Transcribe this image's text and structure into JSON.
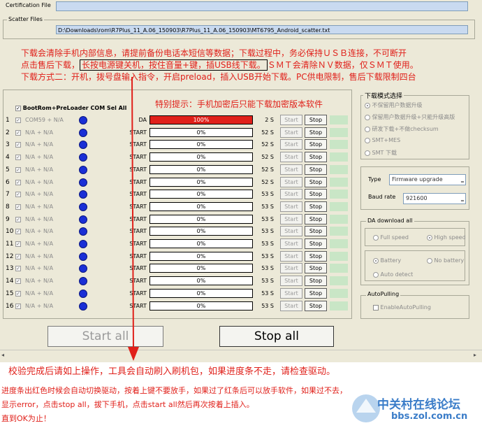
{
  "certification": {
    "label": "Certification File",
    "value": ""
  },
  "scatter": {
    "label": "Scatter Files",
    "value": "D:\\Downloads\\rom\\R7Plus_11_A.06_150903\\R7Plus_11_A.06_150903\\MT6795_Android_scatter.txt"
  },
  "notes": {
    "line1": "下载会清除手机内部信息，请提前备份电话本短信等数据；下载过程中，务必保持ＵＳＢ连接，不可断开",
    "line2a": "点击售后下载，",
    "line2b": "长按电源键关机，按住音量+键，插USB线下载。",
    "line2c": "ＳＭＴ会清除ＮＶ数据，仅ＳＭＴ使用。",
    "line3": "下载方式二：开机，拨号盘输入指令，开启preload，插入USB开始下载。PC供电限制，售后下载限制四台"
  },
  "toggle_all_label": "BootRom+PreLoader COM Sel All",
  "tip": "特别提示：手机加密后只能下载加密版本软件",
  "rows": [
    {
      "num": "1",
      "port": "COM59 + N/A",
      "stage": "DA",
      "progress": "100%",
      "progress_value": 100,
      "time": "2 S",
      "start": "Start",
      "stop": "Stop"
    },
    {
      "num": "2",
      "port": "N/A + N/A",
      "stage": "START",
      "progress": "0%",
      "progress_value": 0,
      "time": "52 S",
      "start": "Start",
      "stop": "Stop"
    },
    {
      "num": "3",
      "port": "N/A + N/A",
      "stage": "START",
      "progress": "0%",
      "progress_value": 0,
      "time": "52 S",
      "start": "Start",
      "stop": "Stop"
    },
    {
      "num": "4",
      "port": "N/A + N/A",
      "stage": "START",
      "progress": "0%",
      "progress_value": 0,
      "time": "52 S",
      "start": "Start",
      "stop": "Stop"
    },
    {
      "num": "5",
      "port": "N/A + N/A",
      "stage": "START",
      "progress": "0%",
      "progress_value": 0,
      "time": "52 S",
      "start": "Start",
      "stop": "Stop"
    },
    {
      "num": "6",
      "port": "N/A + N/A",
      "stage": "START",
      "progress": "0%",
      "progress_value": 0,
      "time": "52 S",
      "start": "Start",
      "stop": "Stop"
    },
    {
      "num": "7",
      "port": "N/A + N/A",
      "stage": "START",
      "progress": "0%",
      "progress_value": 0,
      "time": "53 S",
      "start": "Start",
      "stop": "Stop"
    },
    {
      "num": "8",
      "port": "N/A + N/A",
      "stage": "START",
      "progress": "0%",
      "progress_value": 0,
      "time": "53 S",
      "start": "Start",
      "stop": "Stop"
    },
    {
      "num": "9",
      "port": "N/A + N/A",
      "stage": "START",
      "progress": "0%",
      "progress_value": 0,
      "time": "53 S",
      "start": "Start",
      "stop": "Stop"
    },
    {
      "num": "10",
      "port": "N/A + N/A",
      "stage": "START",
      "progress": "0%",
      "progress_value": 0,
      "time": "53 S",
      "start": "Start",
      "stop": "Stop"
    },
    {
      "num": "11",
      "port": "N/A + N/A",
      "stage": "START",
      "progress": "0%",
      "progress_value": 0,
      "time": "53 S",
      "start": "Start",
      "stop": "Stop"
    },
    {
      "num": "12",
      "port": "N/A + N/A",
      "stage": "START",
      "progress": "0%",
      "progress_value": 0,
      "time": "53 S",
      "start": "Start",
      "stop": "Stop"
    },
    {
      "num": "13",
      "port": "N/A + N/A",
      "stage": "START",
      "progress": "0%",
      "progress_value": 0,
      "time": "53 S",
      "start": "Start",
      "stop": "Stop"
    },
    {
      "num": "14",
      "port": "N/A + N/A",
      "stage": "START",
      "progress": "0%",
      "progress_value": 0,
      "time": "53 S",
      "start": "Start",
      "stop": "Stop"
    },
    {
      "num": "15",
      "port": "N/A + N/A",
      "stage": "START",
      "progress": "0%",
      "progress_value": 0,
      "time": "53 S",
      "start": "Start",
      "stop": "Stop"
    },
    {
      "num": "16",
      "port": "N/A + N/A",
      "stage": "START",
      "progress": "0%",
      "progress_value": 0,
      "time": "53 S",
      "start": "Start",
      "stop": "Stop"
    }
  ],
  "download_mode": {
    "title": "下载模式选择",
    "options": [
      "不保留用户数据升级",
      "保留用户数据升级+只能升级高版",
      "研发下载+不做checksum",
      "SMT+MES",
      "SMT 下载"
    ],
    "selected": 0
  },
  "type": {
    "label": "Type",
    "value": "Firmware upgrade"
  },
  "baud": {
    "label": "Baud rate",
    "value": "921600"
  },
  "da_download": {
    "title": "DA download all",
    "speed_options": [
      "Full speed",
      "High speed"
    ],
    "speed_selected": 1,
    "power_options": [
      "Battery",
      "No battery"
    ],
    "power_selected": 0,
    "auto_detect": "Auto detect"
  },
  "autopulling": {
    "title": "AutoPulling",
    "checkbox": "EnableAutoPulling"
  },
  "buttons": {
    "start_all": "Start all",
    "stop_all": "Stop all"
  },
  "footer": {
    "line1": "校验完成后请如上操作，工具会自动刷入刷机包，如果进度条不走，请检查驱动。",
    "line2": "进度条出红色时候会自动切换驱动，按着上键不要放手，如果过了红条后可以放手软件，如果过不去，",
    "line3": "显示error，点击stop all，拔下手机，点击start all然后再次按着上插入。",
    "line4": "直到OK为止！"
  },
  "watermark": {
    "name": "中关村在线论坛",
    "url": "bbs.zol.com.cn"
  },
  "colors": {
    "note_red": "#e0201a",
    "progress_red": "#e0201a",
    "dot_blue": "#1a2fd6",
    "window_bg": "#ece9d8",
    "field_blue": "#c9daf0"
  }
}
